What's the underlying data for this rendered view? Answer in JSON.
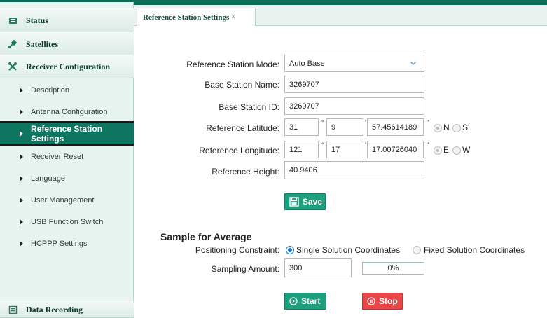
{
  "sidebar": {
    "categories": [
      {
        "label": "Status",
        "icon": "status-icon"
      },
      {
        "label": "Satellites",
        "icon": "satellite-icon"
      },
      {
        "label": "Receiver Configuration",
        "icon": "tools-icon"
      },
      {
        "label": "Data Recording",
        "icon": "data-recording-icon"
      }
    ],
    "items": [
      {
        "label": "Description"
      },
      {
        "label": "Antenna Configuration"
      },
      {
        "label": "Reference Station Settings",
        "active": true
      },
      {
        "label": "Receiver Reset"
      },
      {
        "label": "Language"
      },
      {
        "label": "User Management"
      },
      {
        "label": "USB Function Switch"
      },
      {
        "label": "HCPPP Settings"
      }
    ]
  },
  "tab": {
    "label": "Reference Station Settings",
    "close": "×"
  },
  "form": {
    "mode": {
      "label": "Reference Station Mode:",
      "value": "Auto Base"
    },
    "name": {
      "label": "Base Station Name:",
      "value": "3269707"
    },
    "id": {
      "label": "Base Station ID:",
      "value": "3269707"
    },
    "latitude": {
      "label": "Reference Latitude:",
      "deg": "31",
      "min": "9",
      "sec": "57.45614189",
      "deg_unit": "°",
      "min_unit": "'",
      "sec_unit": "\"",
      "options": [
        "N",
        "S"
      ],
      "selected": "N"
    },
    "longitude": {
      "label": "Reference Longitude:",
      "deg": "121",
      "min": "17",
      "sec": "17.00726040",
      "deg_unit": "°",
      "min_unit": "'",
      "sec_unit": "\"",
      "options": [
        "E",
        "W"
      ],
      "selected": "E"
    },
    "height": {
      "label": "Reference Height:",
      "value": "40.9406"
    },
    "save_label": "Save"
  },
  "sample": {
    "title": "Sample for Average",
    "constraint_label": "Positioning Constraint:",
    "option_single": "Single Solution Coordinates",
    "option_fixed": "Fixed Solution Coordinates",
    "selected": "single",
    "sampling_label": "Sampling Amount:",
    "sampling_value": "300",
    "progress_text": "0%",
    "progress": 0,
    "start_label": "Start",
    "stop_label": "Stop"
  },
  "colors": {
    "brand": "#0d6d57",
    "active_item": "#0e7560",
    "button_green": "#1d9e7c",
    "button_red": "#e8484a",
    "radio_blue": "#1a73c9"
  }
}
